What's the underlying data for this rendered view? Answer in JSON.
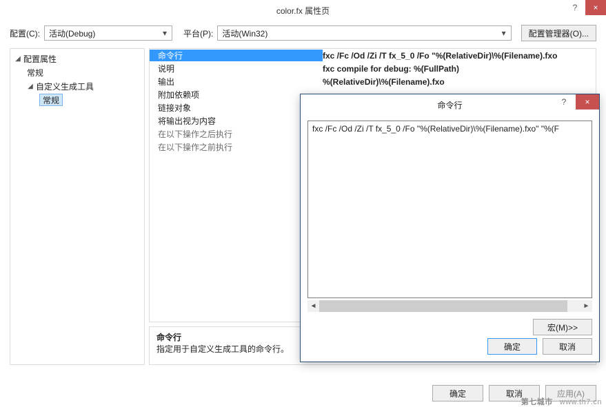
{
  "window": {
    "title": "color.fx 属性页",
    "help_glyph": "?",
    "close_glyph": "×"
  },
  "config": {
    "config_label": "配置(C):",
    "config_value": "活动(Debug)",
    "platform_label": "平台(P):",
    "platform_value": "活动(Win32)",
    "manager_btn": "配置管理器(O)..."
  },
  "tree": {
    "root": "配置属性",
    "item_general": "常规",
    "item_custom_tool": "自定义生成工具",
    "item_custom_tool_general": "常规"
  },
  "grid": {
    "rows": [
      {
        "name_key": "r0",
        "name": "命令行",
        "val_key": "v0",
        "val": "fxc /Fc /Od /Zi /T fx_5_0 /Fo \"%(RelativeDir)\\%(Filename).fxo",
        "selected": true
      },
      {
        "name_key": "r1",
        "name": "说明",
        "val_key": "v1",
        "val": "fxc compile for debug: %(FullPath)"
      },
      {
        "name_key": "r2",
        "name": "输出",
        "val_key": "v2",
        "val": "%(RelativeDir)\\%(Filename).fxo"
      },
      {
        "name_key": "r3",
        "name": "附加依赖项",
        "val_key": "v3",
        "val": ""
      },
      {
        "name_key": "r4",
        "name": "链接对象",
        "val_key": "v4",
        "val": ""
      },
      {
        "name_key": "r5",
        "name": "将输出视为内容",
        "val_key": "v5",
        "val": ""
      },
      {
        "name_key": "r6",
        "name": "在以下操作之后执行",
        "val_key": "v6",
        "val": "",
        "disabled": true
      },
      {
        "name_key": "r7",
        "name": "在以下操作之前执行",
        "val_key": "v7",
        "val": "",
        "disabled": true
      }
    ]
  },
  "desc": {
    "title": "命令行",
    "text": "指定用于自定义生成工具的命令行。"
  },
  "main_buttons": {
    "ok": "确定",
    "cancel": "取消",
    "apply": "应用(A)"
  },
  "popup": {
    "title": "命令行",
    "help_glyph": "?",
    "close_glyph": "×",
    "text": "fxc /Fc /Od /Zi /T fx_5_0 /Fo \"%(RelativeDir)\\%(Filename).fxo\" \"%(F",
    "macros_btn": "宏(M)>>",
    "ok": "确定",
    "cancel": "取消"
  },
  "watermark": {
    "cn": "第七城市",
    "en": "www.th7.cn"
  }
}
